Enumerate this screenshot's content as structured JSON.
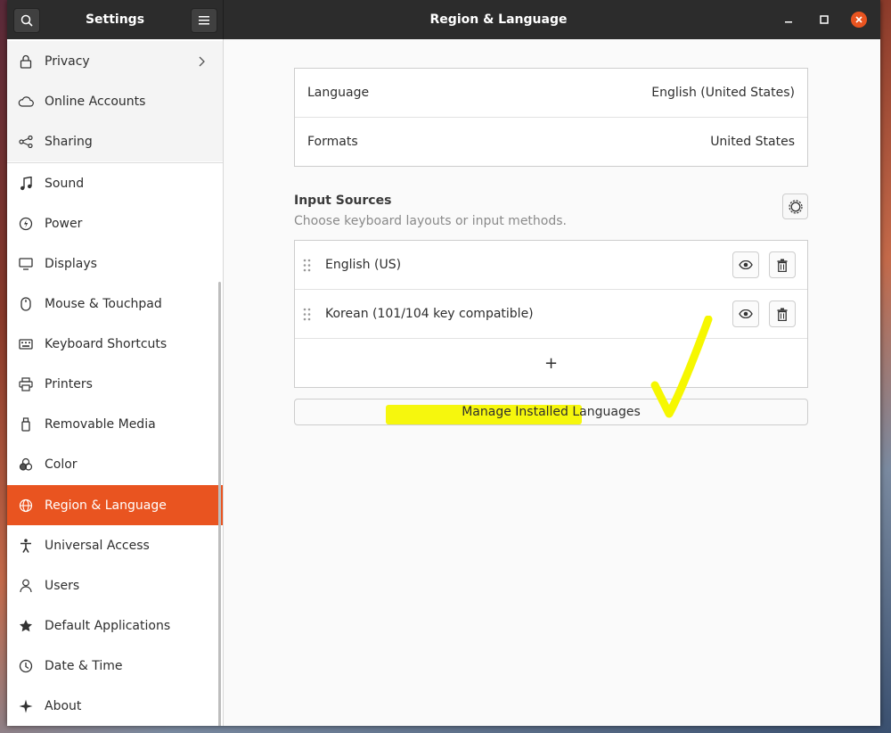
{
  "window": {
    "sidebar_title": "Settings",
    "page_title": "Region & Language"
  },
  "sidebar": {
    "items": [
      {
        "label": "Privacy",
        "icon": "lock-icon"
      },
      {
        "label": "Online Accounts",
        "icon": "cloud-icon"
      },
      {
        "label": "Sharing",
        "icon": "share-icon"
      },
      {
        "label": "Sound",
        "icon": "music-note-icon"
      },
      {
        "label": "Power",
        "icon": "power-icon"
      },
      {
        "label": "Displays",
        "icon": "display-icon"
      },
      {
        "label": "Mouse & Touchpad",
        "icon": "mouse-icon"
      },
      {
        "label": "Keyboard Shortcuts",
        "icon": "keyboard-icon"
      },
      {
        "label": "Printers",
        "icon": "printer-icon"
      },
      {
        "label": "Removable Media",
        "icon": "usb-icon"
      },
      {
        "label": "Color",
        "icon": "color-icon"
      },
      {
        "label": "Region & Language",
        "icon": "globe-icon"
      },
      {
        "label": "Universal Access",
        "icon": "accessibility-icon"
      },
      {
        "label": "Users",
        "icon": "user-icon"
      },
      {
        "label": "Default Applications",
        "icon": "star-icon"
      },
      {
        "label": "Date & Time",
        "icon": "clock-icon"
      },
      {
        "label": "About",
        "icon": "sparkle-icon"
      }
    ],
    "active": "Region & Language"
  },
  "main": {
    "language": {
      "label": "Language",
      "value": "English (United States)"
    },
    "formats": {
      "label": "Formats",
      "value": "United States"
    },
    "input_sources": {
      "title": "Input Sources",
      "subtitle": "Choose keyboard layouts or input methods.",
      "items": [
        {
          "label": "English (US)"
        },
        {
          "label": "Korean (101/104 key compatible)"
        }
      ],
      "add_label": "+"
    },
    "manage_button": "Manage Installed Languages"
  },
  "colors": {
    "accent": "#e95420",
    "titlebar": "#2c2c2c",
    "highlight": "#f6f700"
  }
}
